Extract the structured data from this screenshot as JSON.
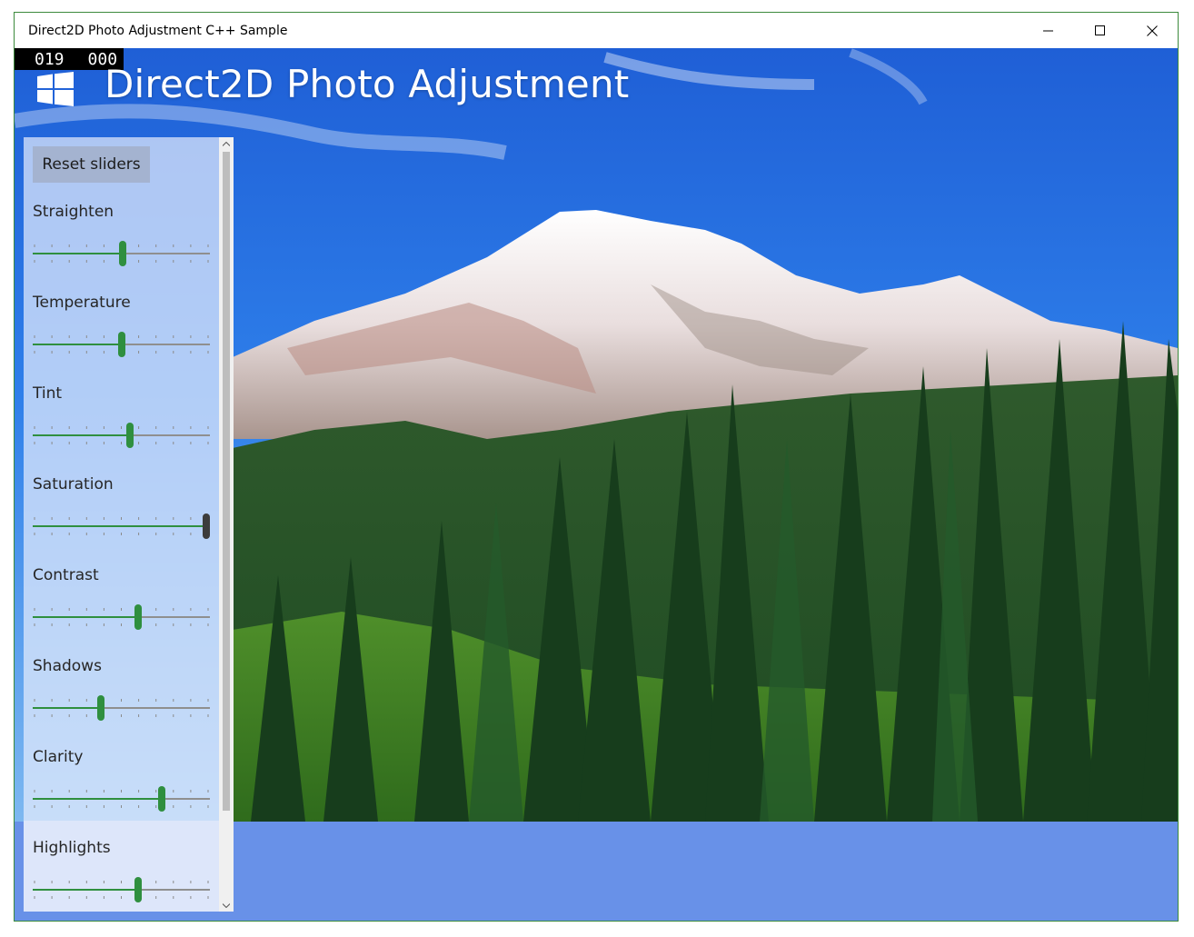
{
  "window": {
    "title": "Direct2D Photo Adjustment C++ Sample",
    "controls": [
      "minimize-icon",
      "maximize-icon",
      "close-icon"
    ]
  },
  "app": {
    "title": "Direct2D Photo Adjustment",
    "fps_left": "019",
    "fps_right": "000",
    "logo_icon": "windows-logo-icon"
  },
  "panel": {
    "reset_label": "Reset sliders",
    "sliders": [
      {
        "label": "Straighten",
        "value": 0.51
      },
      {
        "label": "Temperature",
        "value": 0.5
      },
      {
        "label": "Tint",
        "value": 0.55
      },
      {
        "label": "Saturation",
        "value": 1.0
      },
      {
        "label": "Contrast",
        "value": 0.6
      },
      {
        "label": "Shadows",
        "value": 0.38
      },
      {
        "label": "Clarity",
        "value": 0.74
      },
      {
        "label": "Highlights",
        "value": 0.6
      }
    ]
  },
  "colors": {
    "accent": "#2f8f3f",
    "background": "#6891e8",
    "thumb_max": "#3c3c3c"
  }
}
